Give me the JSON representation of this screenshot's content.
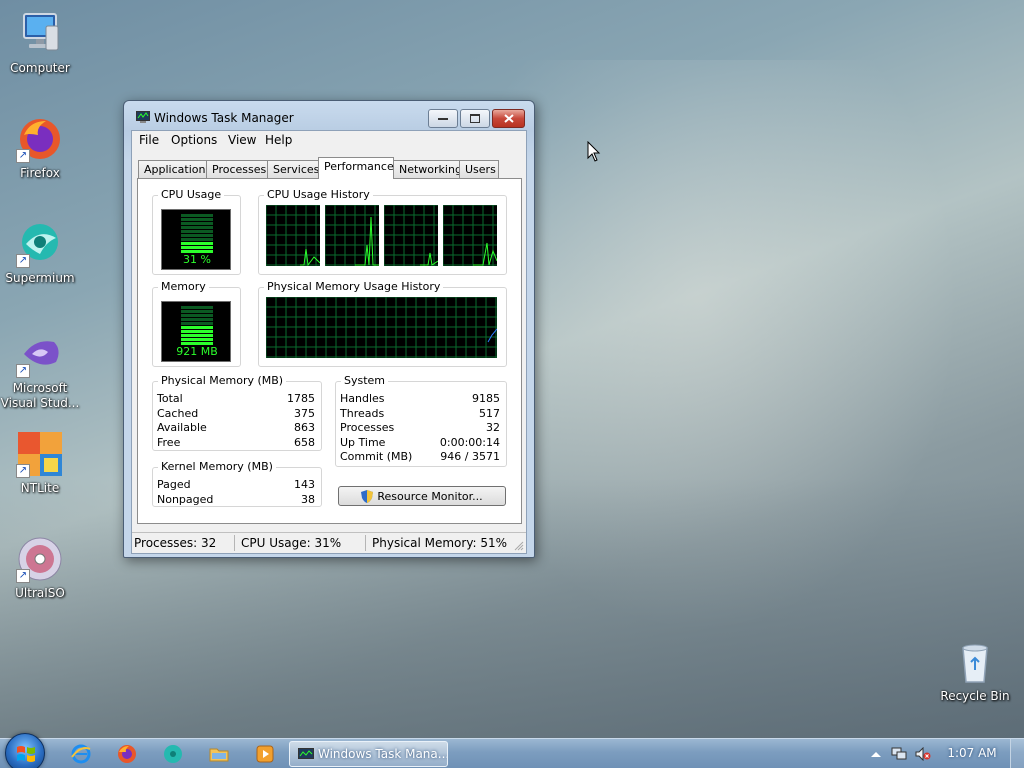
{
  "desktop": {
    "wallpaper_note": "",
    "icons": [
      {
        "label": "Computer",
        "icon": "computer-icon",
        "shortcut": false
      },
      {
        "label": "Firefox",
        "icon": "firefox-icon",
        "shortcut": true
      },
      {
        "label": "Supermium",
        "icon": "supermium-icon",
        "shortcut": true
      },
      {
        "label": "Microsoft Visual Stud...",
        "icon": "visual-studio-icon",
        "shortcut": true
      },
      {
        "label": "NTLite",
        "icon": "ntlite-icon",
        "shortcut": true
      },
      {
        "label": "UltraISO",
        "icon": "ultraiso-icon",
        "shortcut": true
      },
      {
        "label": "Recycle Bin",
        "icon": "recycle-bin-icon",
        "shortcut": false
      }
    ]
  },
  "window": {
    "title": "Windows Task Manager",
    "menu": [
      "File",
      "Options",
      "View",
      "Help"
    ],
    "tabs": [
      {
        "label": "Applications",
        "active": false
      },
      {
        "label": "Processes",
        "active": false
      },
      {
        "label": "Services",
        "active": false
      },
      {
        "label": "Performance",
        "active": true
      },
      {
        "label": "Networking",
        "active": false
      },
      {
        "label": "Users",
        "active": false
      }
    ],
    "performance": {
      "cpu_usage": {
        "label": "CPU Usage",
        "value": "31 %",
        "fraction": 0.31
      },
      "cpu_history": {
        "label": "CPU Usage History",
        "cores": 4
      },
      "memory": {
        "label": "Memory",
        "value": "921 MB",
        "fraction": 0.51
      },
      "memory_history": {
        "label": "Physical Memory Usage History"
      },
      "physical_memory": {
        "label": "Physical Memory (MB)",
        "rows": [
          {
            "key": "Total",
            "value": "1785"
          },
          {
            "key": "Cached",
            "value": "375"
          },
          {
            "key": "Available",
            "value": "863"
          },
          {
            "key": "Free",
            "value": "658"
          }
        ]
      },
      "kernel_memory": {
        "label": "Kernel Memory (MB)",
        "rows": [
          {
            "key": "Paged",
            "value": "143"
          },
          {
            "key": "Nonpaged",
            "value": "38"
          }
        ]
      },
      "system": {
        "label": "System",
        "rows": [
          {
            "key": "Handles",
            "value": "9185"
          },
          {
            "key": "Threads",
            "value": "517"
          },
          {
            "key": "Processes",
            "value": "32"
          },
          {
            "key": "Up Time",
            "value": "0:00:00:14"
          },
          {
            "key": "Commit (MB)",
            "value": "946 / 3571"
          }
        ]
      },
      "resource_monitor_button": "Resource Monitor..."
    },
    "statusbar": {
      "processes": "Processes: 32",
      "cpu": "CPU Usage: 31%",
      "memory": "Physical Memory: 51%"
    }
  },
  "taskbar": {
    "quick_launch": [
      "internet-explorer-icon",
      "firefox-icon",
      "supermium-icon",
      "file-explorer-icon",
      "media-player-icon"
    ],
    "task_button": "Windows Task Mana...",
    "tray_icons": [
      "show-hidden-icons-arrow",
      "network-icon",
      "volume-muted-icon"
    ],
    "clock": "1:07 AM"
  },
  "colors": {
    "graph_green": "#2cff2c",
    "graph_grid": "#0a6b2e",
    "accent_blue": "#1a4fb8"
  }
}
